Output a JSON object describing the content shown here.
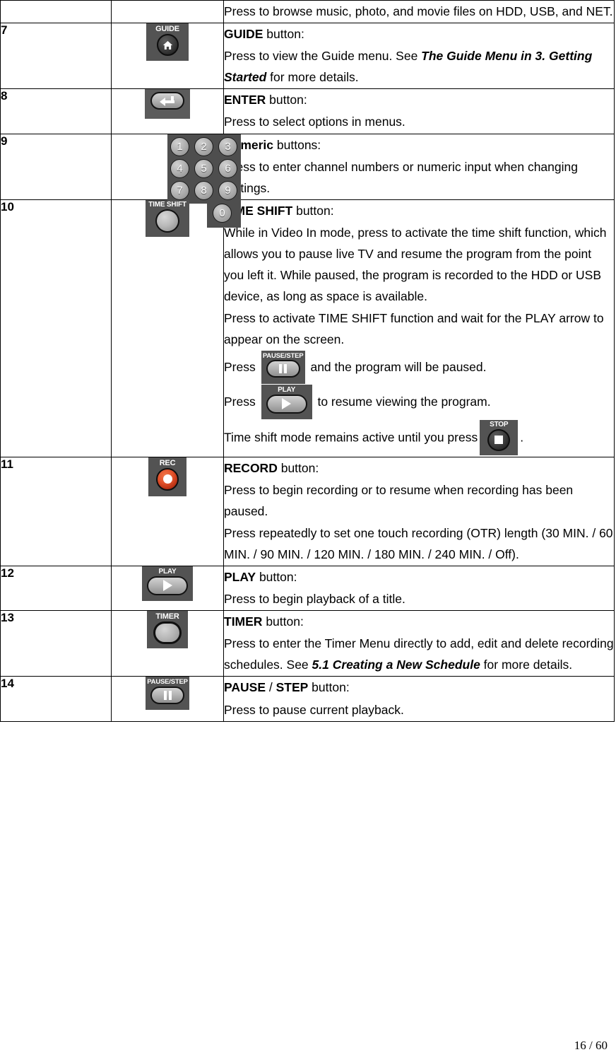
{
  "document": {
    "page_footer": "16 / 60"
  },
  "table": {
    "rows": [
      {
        "num": "",
        "icon": "none",
        "desc_lines": [
          {
            "segments": [
              {
                "text": "Press to browse music, photo, and movie files on HDD, USB, and NET.",
                "style": "normal"
              }
            ]
          }
        ]
      },
      {
        "num": "7",
        "icon": "guide-button-icon",
        "icon_label": "GUIDE",
        "desc_lines": [
          {
            "segments": [
              {
                "text": "GUIDE",
                "style": "bold"
              },
              {
                "text": " button:",
                "style": "normal"
              }
            ]
          },
          {
            "segments": [
              {
                "text": "Press to view the Guide menu. See ",
                "style": "normal"
              },
              {
                "text": "The Guide Menu in 3. Getting Started",
                "style": "bold-italic"
              },
              {
                "text": " for more details.",
                "style": "normal"
              }
            ]
          }
        ]
      },
      {
        "num": "8",
        "icon": "enter-button-icon",
        "icon_label": "",
        "desc_lines": [
          {
            "segments": [
              {
                "text": "ENTER",
                "style": "bold"
              },
              {
                "text": " button:",
                "style": "normal"
              }
            ]
          },
          {
            "segments": [
              {
                "text": "Press to select options in menus.",
                "style": "normal"
              }
            ]
          }
        ]
      },
      {
        "num": "9",
        "icon": "numeric-keypad-icon",
        "icon_label": "",
        "keys": [
          "1",
          "2",
          "3",
          "4",
          "5",
          "6",
          "7",
          "8",
          "9",
          "0"
        ],
        "desc_lines": [
          {
            "segments": [
              {
                "text": "Numeric",
                "style": "bold"
              },
              {
                "text": " buttons:",
                "style": "normal"
              }
            ]
          },
          {
            "segments": [
              {
                "text": "Press to enter channel numbers or numeric input when changing settings.",
                "style": "normal"
              }
            ]
          }
        ]
      },
      {
        "num": "10",
        "icon": "time-shift-button-icon",
        "icon_label": "TIME SHIFT",
        "desc_lines": [
          {
            "segments": [
              {
                "text": "TIME SHIFT",
                "style": "bold"
              },
              {
                "text": " button:",
                "style": "normal"
              }
            ]
          },
          {
            "segments": [
              {
                "text": "While in Video In mode, press to activate the time shift function, which allows you to pause live TV and resume the program from the point you left it. While paused, the program is recorded to the HDD or USB device, as long as space is available.",
                "style": "normal"
              }
            ]
          },
          {
            "segments": [
              {
                "text": "Press to activate TIME SHIFT function and wait for the PLAY arrow to appear on the screen.",
                "style": "normal"
              }
            ]
          },
          {
            "segments": [
              {
                "text": "Press ",
                "style": "normal"
              },
              {
                "text": "[pause-step-icon]",
                "style": "icon"
              },
              {
                "text": " and the program will be paused.",
                "style": "normal"
              }
            ]
          },
          {
            "segments": [
              {
                "text": "Press ",
                "style": "normal"
              },
              {
                "text": "[play-icon]",
                "style": "icon"
              },
              {
                "text": " to resume viewing the program.",
                "style": "normal"
              }
            ]
          },
          {
            "segments": [
              {
                "text": "Time shift mode remains active until you press",
                "style": "normal"
              },
              {
                "text": "[stop-icon]",
                "style": "icon"
              },
              {
                "text": ".",
                "style": "normal"
              }
            ]
          }
        ]
      },
      {
        "num": "11",
        "icon": "record-button-icon",
        "icon_label": "REC",
        "desc_lines": [
          {
            "segments": [
              {
                "text": "RECORD",
                "style": "bold"
              },
              {
                "text": " button:",
                "style": "normal"
              }
            ]
          },
          {
            "segments": [
              {
                "text": "Press to begin recording or to resume when recording has been paused.",
                "style": "normal"
              }
            ]
          },
          {
            "segments": [
              {
                "text": "Press repeatedly to set one touch recording (OTR) length (30 MIN. / 60 MIN. / 90 MIN. / 120 MIN. / 180 MIN. /  240 MIN. /  Off).",
                "style": "normal"
              }
            ]
          }
        ]
      },
      {
        "num": "12",
        "icon": "play-button-icon",
        "icon_label": "PLAY",
        "desc_lines": [
          {
            "segments": [
              {
                "text": "PLAY",
                "style": "bold"
              },
              {
                "text": " button:",
                "style": "normal"
              }
            ]
          },
          {
            "segments": [
              {
                "text": "Press to begin playback of a title.",
                "style": "normal"
              }
            ]
          }
        ]
      },
      {
        "num": "13",
        "icon": "timer-button-icon",
        "icon_label": "TIMER",
        "desc_lines": [
          {
            "segments": [
              {
                "text": "TIMER",
                "style": "bold"
              },
              {
                "text": " button:",
                "style": "normal"
              }
            ]
          },
          {
            "segments": [
              {
                "text": "Press to enter the Timer Menu directly to add, edit and delete recording schedules. See ",
                "style": "normal"
              },
              {
                "text": "5.1 Creating a New Schedule",
                "style": "bold-italic"
              },
              {
                "text": " for more details.",
                "style": "normal"
              }
            ]
          }
        ]
      },
      {
        "num": "14",
        "icon": "pause-step-button-icon",
        "icon_label": "PAUSE/STEP",
        "desc_lines": [
          {
            "segments": [
              {
                "text": "PAUSE",
                "style": "bold"
              },
              {
                "text": " / ",
                "style": "normal"
              },
              {
                "text": "STEP",
                "style": "bold"
              },
              {
                "text": " button:",
                "style": "normal"
              }
            ]
          },
          {
            "segments": [
              {
                "text": "Press to pause current playback.",
                "style": "normal"
              }
            ]
          }
        ]
      }
    ]
  },
  "icon_labels": {
    "guide": "GUIDE",
    "time_shift": "TIME SHIFT",
    "rec": "REC",
    "play": "PLAY",
    "timer": "TIMER",
    "pause_step": "PAUSE/STEP",
    "stop": "STOP"
  },
  "colors": {
    "icon_background": "#535353",
    "record_accent": "#e2512a",
    "border": "#000000",
    "text": "#000000"
  }
}
